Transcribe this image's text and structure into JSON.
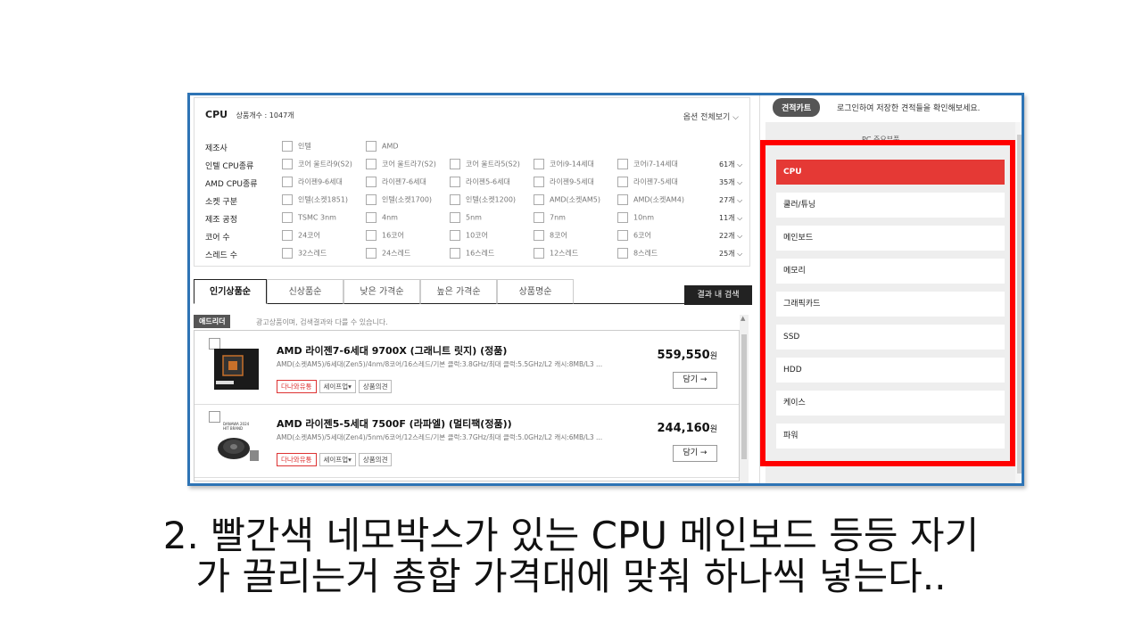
{
  "filter": {
    "category": "CPU",
    "count_label": "상품개수 : 1047개",
    "view_all": "옵션 전체보기",
    "rows": [
      {
        "label": "제조사",
        "items": [
          "인텔",
          "AMD"
        ],
        "count": ""
      },
      {
        "label": "인텔 CPU종류",
        "items": [
          "코어 울트라9(S2)",
          "코어 울트라7(S2)",
          "코어 울트라5(S2)",
          "코어i9-14세대",
          "코어i7-14세대"
        ],
        "count": "61개"
      },
      {
        "label": "AMD CPU종류",
        "items": [
          "라이젠9-6세대",
          "라이젠7-6세대",
          "라이젠5-6세대",
          "라이젠9-5세대",
          "라이젠7-5세대"
        ],
        "count": "35개"
      },
      {
        "label": "소켓 구분",
        "items": [
          "인텔(소켓1851)",
          "인텔(소켓1700)",
          "인텔(소켓1200)",
          "AMD(소켓AM5)",
          "AMD(소켓AM4)"
        ],
        "count": "27개"
      },
      {
        "label": "제조 공정",
        "items": [
          "TSMC 3nm",
          "4nm",
          "5nm",
          "7nm",
          "10nm"
        ],
        "count": "11개"
      },
      {
        "label": "코어 수",
        "items": [
          "24코어",
          "16코어",
          "10코어",
          "8코어",
          "6코어"
        ],
        "count": "22개"
      },
      {
        "label": "스레드 수",
        "items": [
          "32스레드",
          "24스레드",
          "16스레드",
          "12스레드",
          "8스레드"
        ],
        "count": "25개"
      }
    ]
  },
  "tabs": [
    "인기상품순",
    "신상품순",
    "낮은 가격순",
    "높은 가격순",
    "상품명순"
  ],
  "search_in_results": "결과 내 검색",
  "ad": {
    "tag": "애드리더",
    "text": "광고상품이며, 검색결과와 다를 수 있습니다."
  },
  "products": [
    {
      "name": "AMD 라이젠7-6세대 9700X (그래니트 릿지) (정품)",
      "spec": "AMD(소켓AM5)/6세대(Zen5)/4nm/8코어/16스레드/기본 클럭:3.8GHz/최대 클럭:5.5GHz/L2 캐시:8MB/L3 ...",
      "tags": [
        "다나와유통",
        "세이프업",
        "상품의견"
      ],
      "price": "559,550",
      "currency": "원",
      "cart": "담기 →"
    },
    {
      "name": "AMD 라이젠5-5세대 7500F (라파엘) (멀티팩(정품))",
      "spec": "AMD(소켓AM5)/5세대(Zen4)/5nm/6코어/12스레드/기본 클럭:3.7GHz/최대 클럭:5.0GHz/L2 캐시:6MB/L3 ...",
      "tags": [
        "다나와유통",
        "세이프업",
        "상품의견"
      ],
      "price": "244,160",
      "currency": "원",
      "cart": "담기 →",
      "badge": "DANAWA 2024 HIT BRAND"
    }
  ],
  "estimate": {
    "button": "견적카트",
    "note": "로그인하여 저장한 견적들을 확인해보세요.",
    "peek": "PC 주요부품"
  },
  "categories": [
    "CPU",
    "쿨러/튜닝",
    "메인보드",
    "메모리",
    "그래픽카드",
    "SSD",
    "HDD",
    "케이스",
    "파워"
  ],
  "caption": {
    "line1": "2. 빨간색 네모박스가 있는 CPU 메인보드 등등 자기",
    "line2": "가 끌리는거 총합 가격대에 맞춰 하나씩 넣는다.."
  },
  "colors": {
    "accent": "#e53935",
    "highlight": "#ff0000",
    "frame": "#2e74b5"
  }
}
